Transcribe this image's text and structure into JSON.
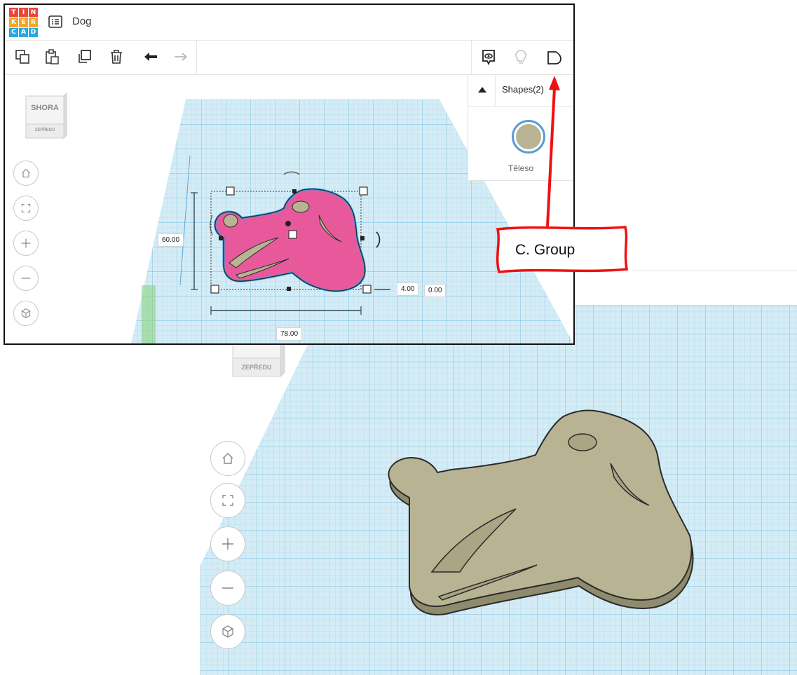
{
  "app": {
    "logo_letters": [
      "T",
      "I",
      "N",
      "K",
      "E",
      "R",
      "C",
      "A",
      "D"
    ],
    "logo_colors": [
      "#e8473c",
      "#e8473c",
      "#e8473c",
      "#f5a623",
      "#f5a623",
      "#f5a623",
      "#28a9e1",
      "#28a9e1",
      "#28a9e1"
    ],
    "document_title": "Dog"
  },
  "toolbar": {
    "left_icons": [
      "copy-icon",
      "paste-icon",
      "duplicate-icon",
      "delete-icon",
      "undo-icon",
      "redo-icon"
    ],
    "right_icons": [
      "show-all-icon",
      "bulb-icon",
      "group-icon"
    ]
  },
  "view_cube": {
    "top_label": "SHORA",
    "front_label": "ZEPŘEDU"
  },
  "nav_controls": [
    "home-icon",
    "fit-icon",
    "zoom-in-icon",
    "zoom-out-icon",
    "perspective-icon"
  ],
  "shapes_panel": {
    "title": "Shapes(2)",
    "swatch_label": "Těleso",
    "swatch_color": "#b8b493"
  },
  "dimensions": {
    "height": "60.00",
    "width": "78.00",
    "depth": "4.00",
    "elevation": "0.00"
  },
  "callout": {
    "text": "C. Group",
    "color": "#ee1111"
  },
  "colors": {
    "grid_bg": "#d9edf5",
    "grid_line": "#8ecae6",
    "shape_pink": "#e8599c",
    "shape_tan": "#b8b493",
    "outline": "#2b2b2b",
    "selection_blue": "#3aa0e8"
  }
}
